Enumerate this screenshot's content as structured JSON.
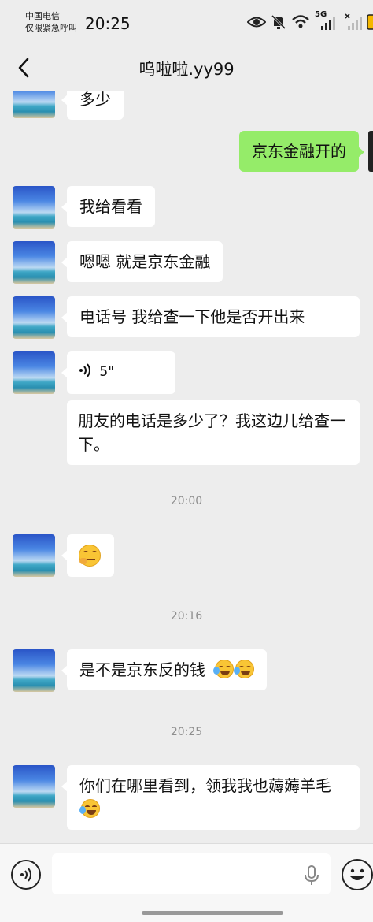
{
  "status_bar": {
    "carrier_line1": "中国电信",
    "carrier_line2": "仅限紧急呼叫",
    "time": "20:25",
    "network": "5G"
  },
  "nav": {
    "title": "呜啦啦.yy99"
  },
  "messages": [
    {
      "dir": "in",
      "text": "多少"
    },
    {
      "dir": "out",
      "text": "京东金融开的"
    },
    {
      "dir": "in",
      "text": "我给看看"
    },
    {
      "dir": "in",
      "text": "嗯嗯 就是京东金融"
    },
    {
      "dir": "in",
      "text": "电话号 我给查一下他是否开出来"
    },
    {
      "dir": "in",
      "type": "voice",
      "text": "5\""
    },
    {
      "dir": "in",
      "text": "朋友的电话是多少了？我这边儿给查一下。"
    },
    {
      "dir": "in",
      "text": ""
    },
    {
      "dir": "in",
      "text": "是不是京东反的钱"
    },
    {
      "dir": "in",
      "text": "你们在哪里看到，领我我也薅薅羊毛"
    }
  ],
  "timestamps": [
    "20:00",
    "20:16",
    "20:25"
  ],
  "emoji_icons": {
    "thinking": "thinking-face-emoji",
    "laughing_crying": "laughing-crying-emoji"
  },
  "colors": {
    "background": "#ededed",
    "incoming_bubble": "#ffffff",
    "outgoing_bubble": "#95ec69",
    "timestamp_text": "#8e8e8e"
  }
}
